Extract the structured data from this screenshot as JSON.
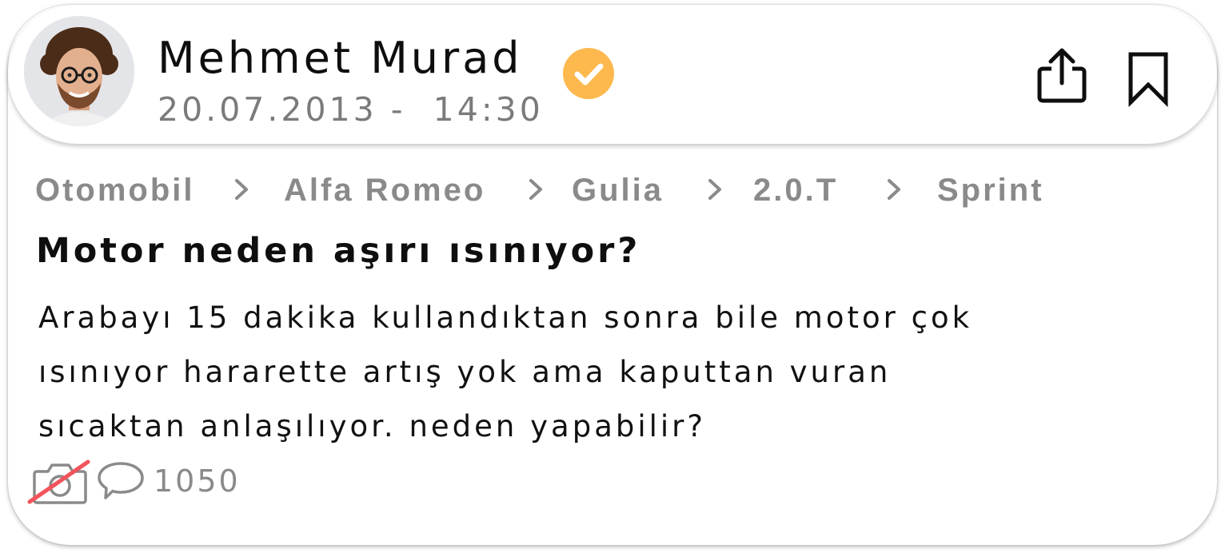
{
  "author": {
    "name": "Mehmet Murad",
    "verified": true,
    "verified_color": "#FDB94E",
    "avatar_icon": "profile-photo"
  },
  "post": {
    "date": "20.07.2013",
    "separator": "-",
    "time": "14:30",
    "title": "Motor neden aşırı ısınıyor?",
    "body_lines": [
      "Arabayı 15 dakika kullandıktan sonra bile motor çok",
      "ısınıyor hararette artış yok ama kaputtan vuran",
      "sıcaktan anlaşılıyor. neden yapabilir?"
    ]
  },
  "breadcrumb": {
    "items": [
      "Otomobil",
      "Alfa Romeo",
      "Gulia",
      "2.0.T",
      "Sprint"
    ],
    "separator_icon": "chevron-right-icon"
  },
  "actions": {
    "share_icon": "share-icon",
    "bookmark_icon": "bookmark-icon"
  },
  "stats": {
    "photo_icon": "no-photo-icon",
    "no_photo_color": "#F2545B",
    "comment_icon": "comment-icon",
    "comment_count": "1050"
  }
}
